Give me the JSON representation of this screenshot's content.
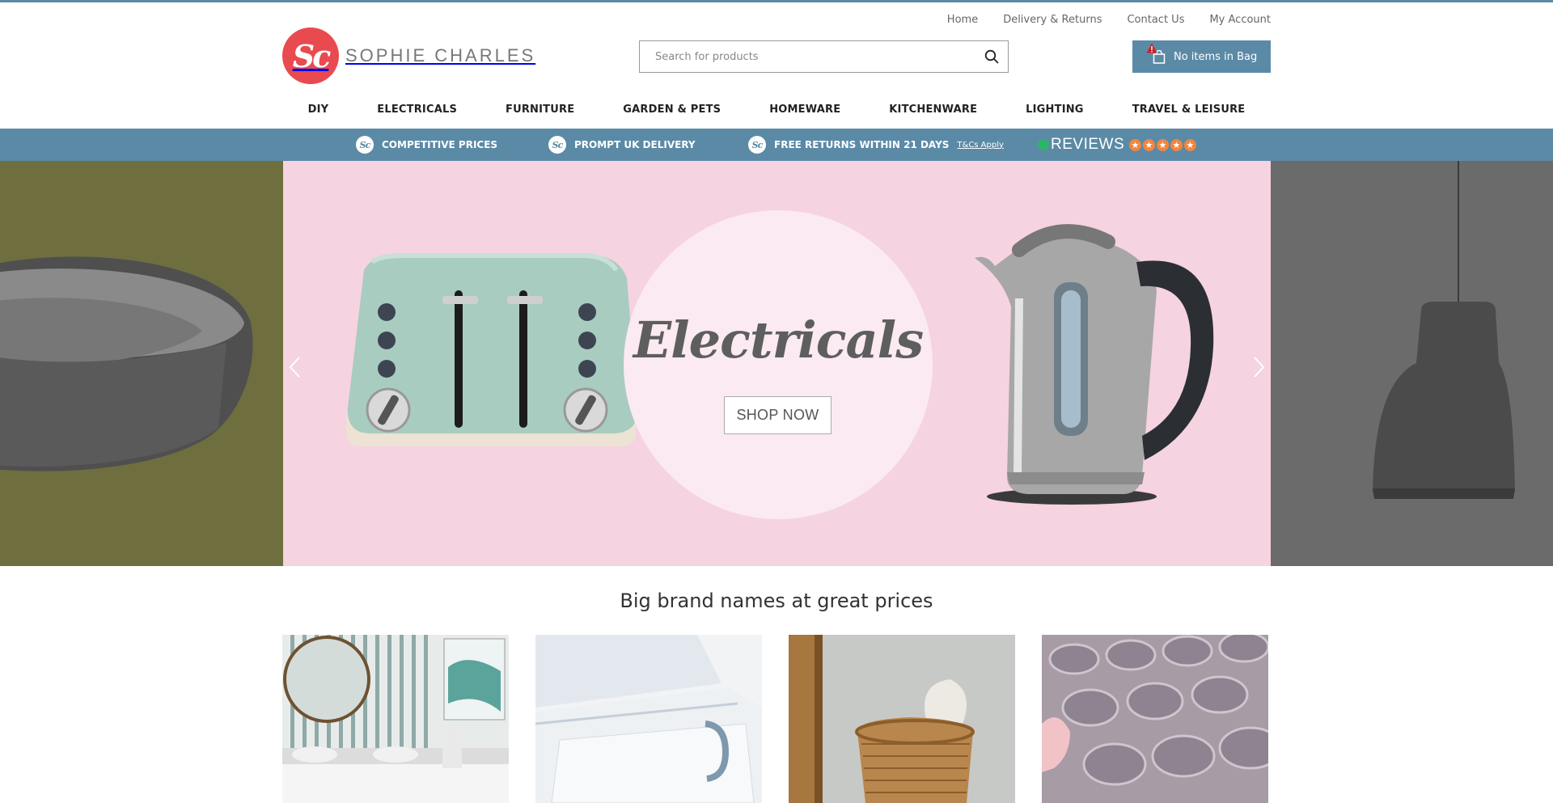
{
  "header": {
    "utility_links": [
      "Home",
      "Delivery & Returns",
      "Contact Us",
      "My Account"
    ],
    "logo": {
      "mark": "Sc",
      "text": "SOPHIE CHARLES"
    },
    "search": {
      "placeholder": "Search for products",
      "value": ""
    },
    "bag": {
      "label": "No items in Bag"
    }
  },
  "nav": {
    "items": [
      "DIY",
      "ELECTRICALS",
      "FURNITURE",
      "GARDEN & PETS",
      "HOMEWARE",
      "KITCHENWARE",
      "LIGHTING",
      "TRAVEL & LEISURE"
    ]
  },
  "usp": {
    "items": [
      "COMPETITIVE PRICES",
      "PROMPT UK DELIVERY",
      "FREE RETURNS WITHIN 21 DAYS"
    ],
    "terms": "T&Cs Apply",
    "reviews_label": "REVIEWS",
    "rating_stars": 5
  },
  "hero": {
    "title": "Electricals",
    "button": "SHOP NOW"
  },
  "section": {
    "title": "Big brand names at great prices"
  },
  "colors": {
    "brand_blue": "#5b8aa6",
    "brand_red": "#e84a4f",
    "hero_pink": "#f6d3e1",
    "star_orange": "#f4853d"
  }
}
